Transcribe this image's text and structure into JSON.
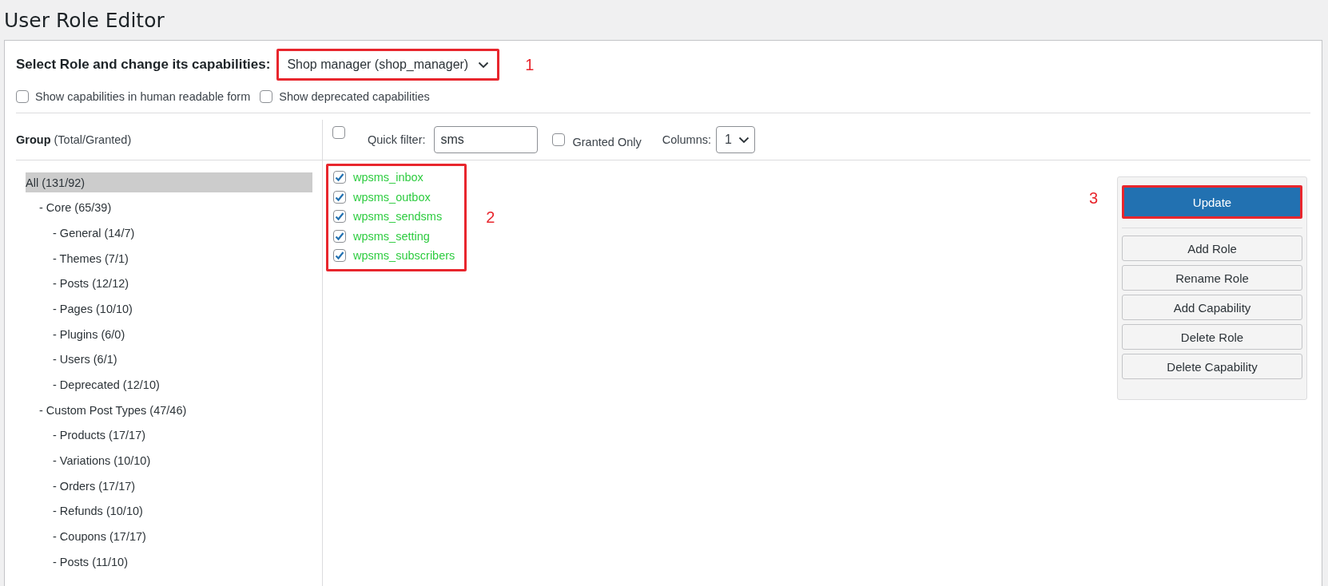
{
  "page_title": "User Role Editor",
  "role_select": {
    "label": "Select Role and change its capabilities:",
    "value": "Shop manager (shop_manager)",
    "callout": "1"
  },
  "options": [
    {
      "label": "Show capabilities in human readable form",
      "checked": false
    },
    {
      "label": "Show deprecated capabilities",
      "checked": false
    }
  ],
  "groups_header": {
    "title": "Group",
    "subtitle": "(Total/Granted)"
  },
  "groups": [
    {
      "label": "All (131/92)",
      "selected": true,
      "children": [
        {
          "label": "- Core (65/39)",
          "selected": false,
          "children": [
            {
              "label": "- General (14/7)",
              "selected": false
            },
            {
              "label": "- Themes (7/1)",
              "selected": false
            },
            {
              "label": "- Posts (12/12)",
              "selected": false
            },
            {
              "label": "- Pages (10/10)",
              "selected": false
            },
            {
              "label": "- Plugins (6/0)",
              "selected": false
            },
            {
              "label": "- Users (6/1)",
              "selected": false
            },
            {
              "label": "- Deprecated (12/10)",
              "selected": false
            }
          ]
        },
        {
          "label": "- Custom Post Types (47/46)",
          "selected": false,
          "children": [
            {
              "label": "- Products (17/17)",
              "selected": false
            },
            {
              "label": "- Variations (10/10)",
              "selected": false
            },
            {
              "label": "- Orders (17/17)",
              "selected": false
            },
            {
              "label": "- Refunds (10/10)",
              "selected": false
            },
            {
              "label": "- Coupons (17/17)",
              "selected": false
            },
            {
              "label": "- Posts (11/10)",
              "selected": false
            }
          ]
        }
      ]
    }
  ],
  "toolbar": {
    "select_all": false,
    "filter_label": "Quick filter:",
    "filter_value": "sms",
    "granted_only": {
      "label": "Granted Only",
      "checked": false
    },
    "columns_label": "Columns:",
    "columns_value": "1"
  },
  "capabilities": {
    "callout": "2",
    "items": [
      {
        "name": "wpsms_inbox",
        "checked": true
      },
      {
        "name": "wpsms_outbox",
        "checked": true
      },
      {
        "name": "wpsms_sendsms",
        "checked": true
      },
      {
        "name": "wpsms_setting",
        "checked": true
      },
      {
        "name": "wpsms_subscribers",
        "checked": true
      }
    ]
  },
  "actions": {
    "primary": {
      "label": "Update",
      "callout": "3"
    },
    "buttons": [
      "Add Role",
      "Rename Role",
      "Add Capability",
      "Delete Role",
      "Delete Capability"
    ]
  }
}
